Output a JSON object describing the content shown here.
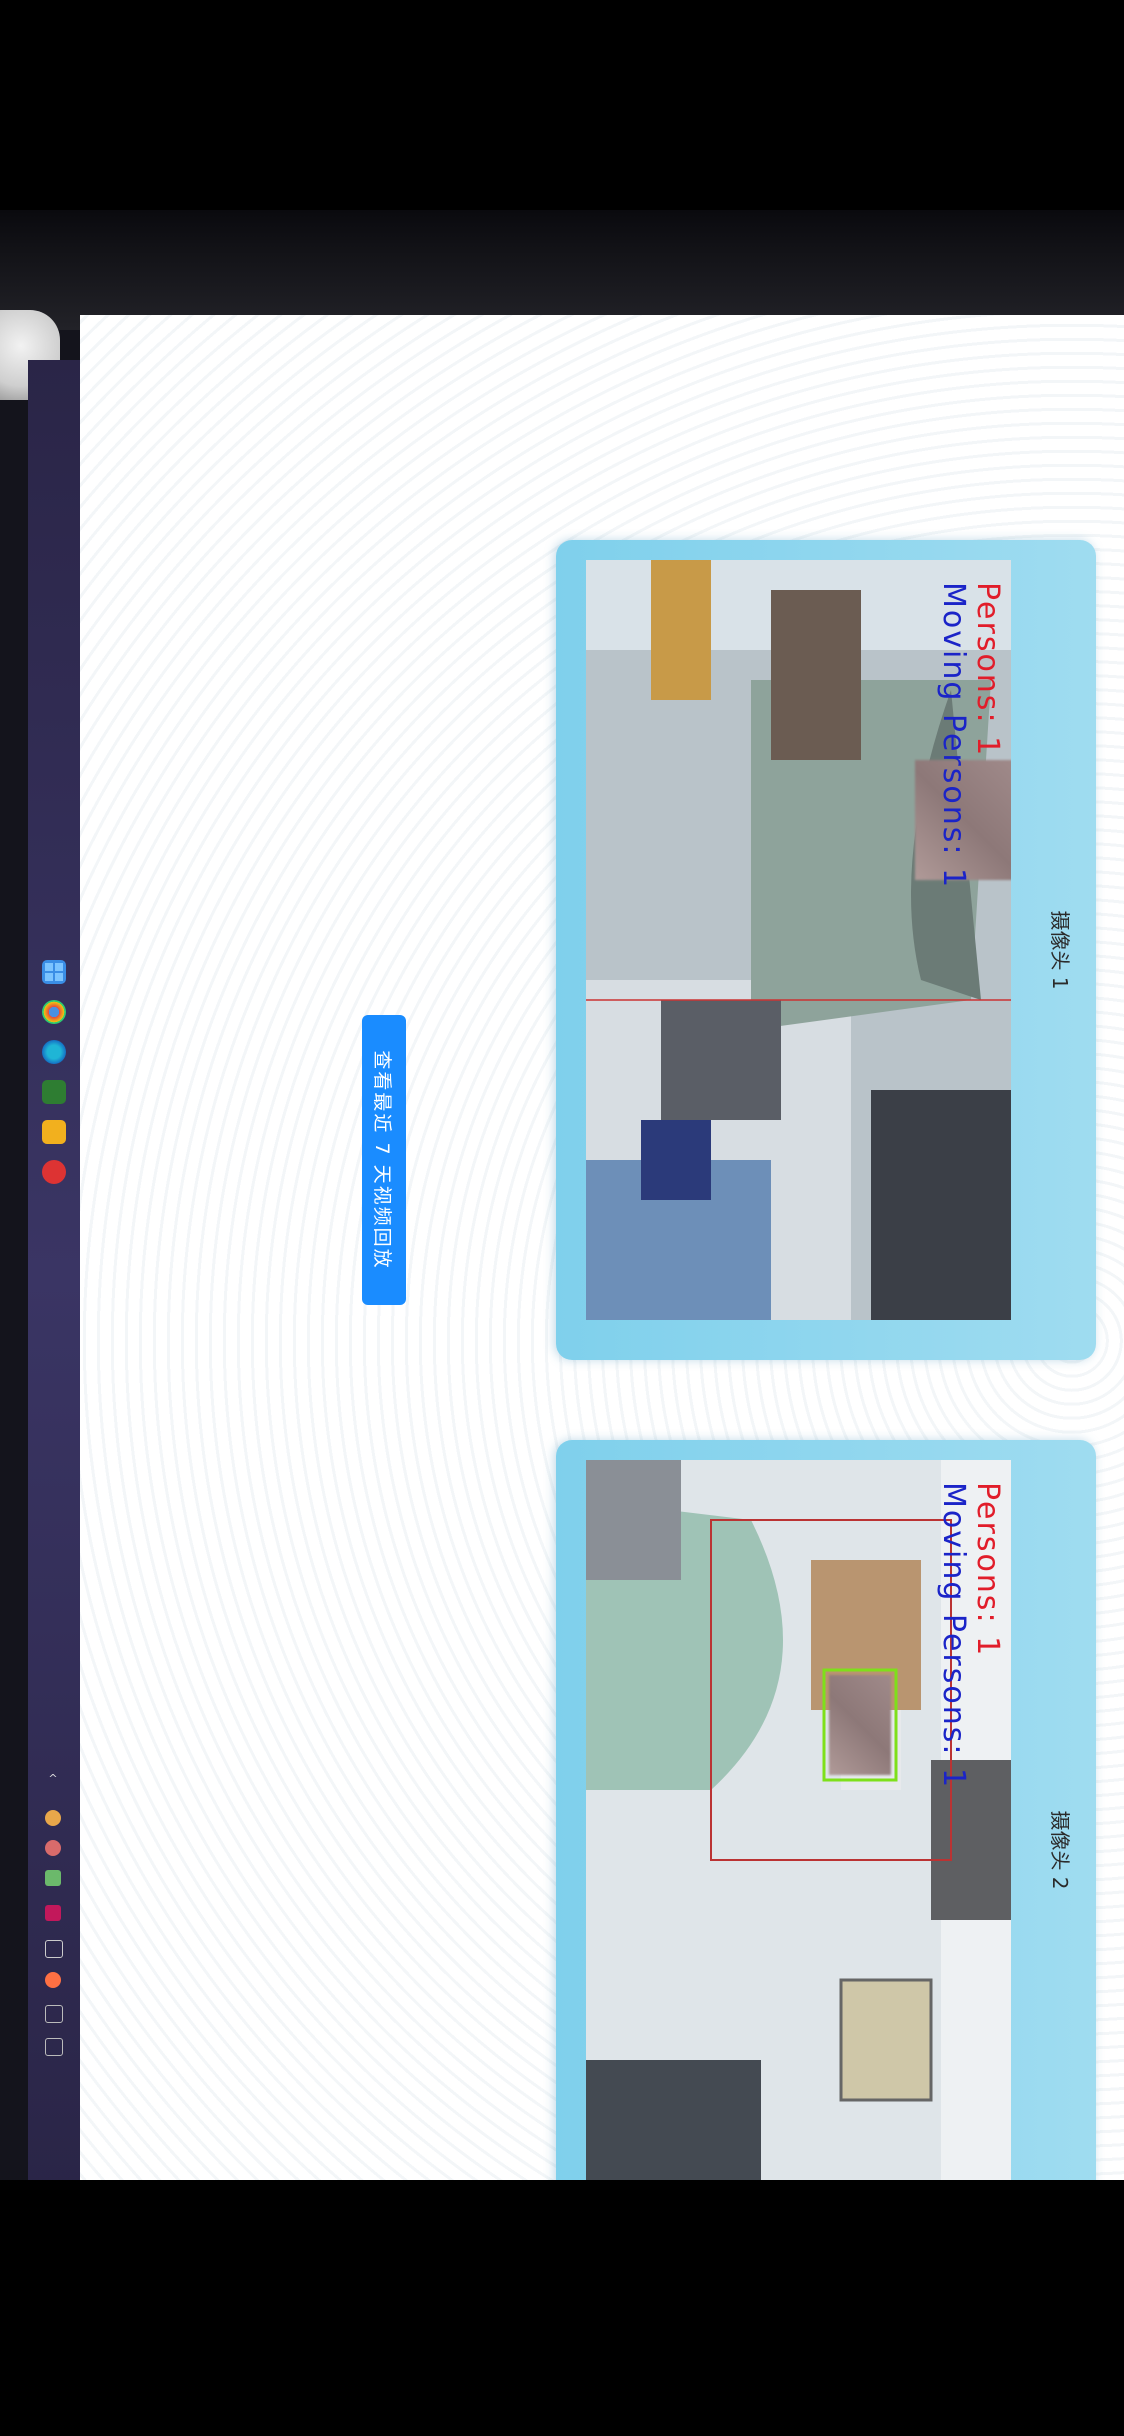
{
  "cameras": [
    {
      "title": "摄像头 1",
      "overlay_persons": "Persons: 1",
      "overlay_moving": "Moving Persons: 1"
    },
    {
      "title": "摄像头 2",
      "overlay_persons": "Persons: 1",
      "overlay_moving": "Moving Persons: 1"
    }
  ],
  "actions": {
    "replay_label": "查看最近 7 天视频回放"
  },
  "taskbar": {
    "icons": [
      "windows-start-icon",
      "chrome-icon",
      "edge-icon",
      "image-app-icon",
      "folder-icon",
      "app-icon"
    ],
    "tray_icons": [
      "chevron-up-icon",
      "tray-icon",
      "tray-icon",
      "network-icon",
      "tray-icon",
      "tray-icon",
      "tray-icon",
      "tray-icon",
      "tray-icon"
    ]
  },
  "colors": {
    "card_bg": "#8fd6ee",
    "button_bg": "#1a8cff",
    "overlay_red": "#e11d2a",
    "overlay_blue": "#1b24c8",
    "detection_box_green": "#7ee01a"
  }
}
